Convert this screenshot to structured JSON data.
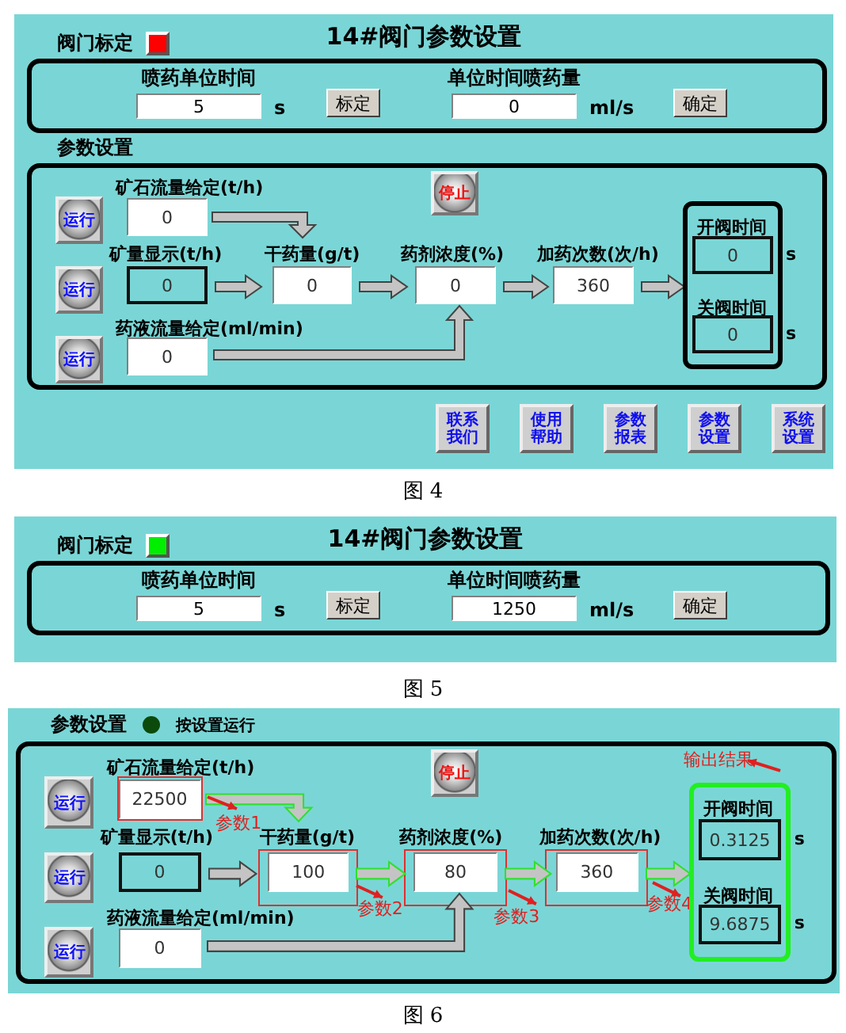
{
  "figures": [
    {
      "caption": "图 4",
      "title": "14#阀门参数设置",
      "calibration": {
        "label": "阀门标定",
        "color": "#ff0000"
      },
      "spray": [
        {
          "label": "喷药单位时间",
          "value": "5",
          "unit": "s",
          "button": "标定"
        },
        {
          "label": "单位时间喷药量",
          "value": "0",
          "unit": "ml/s",
          "button": "确定"
        }
      ],
      "params": {
        "label": "参数设置",
        "stop_button": "停止",
        "run_buttons": [
          "运行",
          "运行",
          "运行"
        ],
        "ore_flow": {
          "label": "矿石流量给定(t/h)",
          "value": "0",
          "kind": "input"
        },
        "ore_display": {
          "label": "矿量显示(t/h)",
          "value": "0",
          "kind": "display"
        },
        "dry_dose": {
          "label": "干药量(g/t)",
          "value": "0",
          "kind": "input"
        },
        "concentration": {
          "label": "药剂浓度(%)",
          "value": "0",
          "kind": "input"
        },
        "dosing_times": {
          "label": "加药次数(次/h)",
          "value": "360",
          "kind": "input"
        },
        "liquid_flow": {
          "label": "药液流量给定(ml/min)",
          "value": "0",
          "kind": "input"
        },
        "output": {
          "open": {
            "label": "开阀时间",
            "value": "0",
            "unit": "s",
            "kind": "display"
          },
          "close": {
            "label": "关阀时间",
            "value": "0",
            "unit": "s",
            "kind": "display"
          }
        }
      },
      "nav_buttons": [
        "联系我们",
        "使用帮助",
        "参数报表",
        "参数设置",
        "系统设置"
      ]
    },
    {
      "caption": "图 5",
      "title": "14#阀门参数设置",
      "calibration": {
        "label": "阀门标定",
        "color": "#00ee00"
      },
      "spray": [
        {
          "label": "喷药单位时间",
          "value": "5",
          "unit": "s",
          "button": "标定"
        },
        {
          "label": "单位时间喷药量",
          "value": "1250",
          "unit": "ml/s",
          "button": "确定"
        }
      ]
    },
    {
      "caption": "图 6",
      "params": {
        "label": "参数设置",
        "status": {
          "label": "按设置运行",
          "color": "#0b4a0b"
        },
        "stop_button": "停止",
        "run_buttons": [
          "运行",
          "运行",
          "运行"
        ],
        "ore_flow": {
          "label": "矿石流量给定(t/h)",
          "value": "22500",
          "kind": "input",
          "note": "参数1"
        },
        "ore_display": {
          "label": "矿量显示(t/h)",
          "value": "0",
          "kind": "display"
        },
        "dry_dose": {
          "label": "干药量(g/t)",
          "value": "100",
          "kind": "input",
          "note": "参数2"
        },
        "concentration": {
          "label": "药剂浓度(%)",
          "value": "80",
          "kind": "input",
          "note": "参数3"
        },
        "dosing_times": {
          "label": "加药次数(次/h)",
          "value": "360",
          "kind": "input",
          "note": "参数4"
        },
        "liquid_flow": {
          "label": "药液流量给定(ml/min)",
          "value": "0",
          "kind": "input"
        },
        "output": {
          "note": "输出结果",
          "open": {
            "label": "开阀时间",
            "value": "0.3125",
            "unit": "s",
            "kind": "display"
          },
          "close": {
            "label": "关阀时间",
            "value": "9.6875",
            "unit": "s",
            "kind": "display"
          }
        }
      }
    }
  ]
}
